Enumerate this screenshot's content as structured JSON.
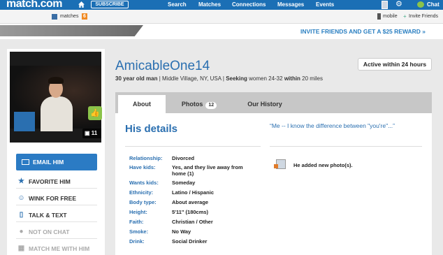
{
  "topnav": {
    "logo": "match.com",
    "subscribe": "SUBSCRIBE",
    "items": [
      "Search",
      "Matches",
      "Connections",
      "Messages",
      "Events"
    ],
    "chat": "Chat"
  },
  "subbar": {
    "matches_label": "matches",
    "matches_count": "6",
    "mobile": "mobile",
    "invite": "Invite Friends"
  },
  "banner": {
    "text": "INVITE FRIENDS AND GET A $25 REWARD »"
  },
  "profile": {
    "username": "AmicableOne14",
    "age_gender": "30 year old man",
    "location": "Middle Village, NY, USA",
    "seeking_label": "Seeking",
    "seeking_value": "women 24-32",
    "within_label": "within",
    "within_value": "20 miles",
    "active_status": "Active within 24 hours",
    "photo_count": "11"
  },
  "actions": {
    "email": "EMAIL HIM",
    "favorite": "FAVORITE HIM",
    "wink": "WINK FOR FREE",
    "talk": "TALK & TEXT",
    "not_on_chat": "NOT ON CHAT",
    "match_me": "MATCH ME WITH HIM"
  },
  "tabs": [
    {
      "label": "About"
    },
    {
      "label": "Photos",
      "count": "12"
    },
    {
      "label": "Our History"
    }
  ],
  "details": {
    "title": "His details",
    "rows": [
      {
        "key": "Relationship:",
        "value": "Divorced"
      },
      {
        "key": "Have kids:",
        "value": "Yes, and they live away from home (1)"
      },
      {
        "key": "Wants kids:",
        "value": "Someday"
      },
      {
        "key": "Ethnicity:",
        "value": "Latino / Hispanic"
      },
      {
        "key": "Body type:",
        "value": "About average"
      },
      {
        "key": "Height:",
        "value": "5'11\" (180cms)"
      },
      {
        "key": "Faith:",
        "value": "Christian / Other"
      },
      {
        "key": "Smoke:",
        "value": "No Way"
      },
      {
        "key": "Drink:",
        "value": "Social Drinker"
      }
    ]
  },
  "quote": "“Me -- I know the difference between \"you're\"...”",
  "activity": "He added new photo(s).",
  "colors": {
    "nav_blue": "#1b6fb5",
    "link_blue": "#2a6fb0",
    "accent_green": "#8bc34a",
    "badge_orange": "#f08a24"
  }
}
